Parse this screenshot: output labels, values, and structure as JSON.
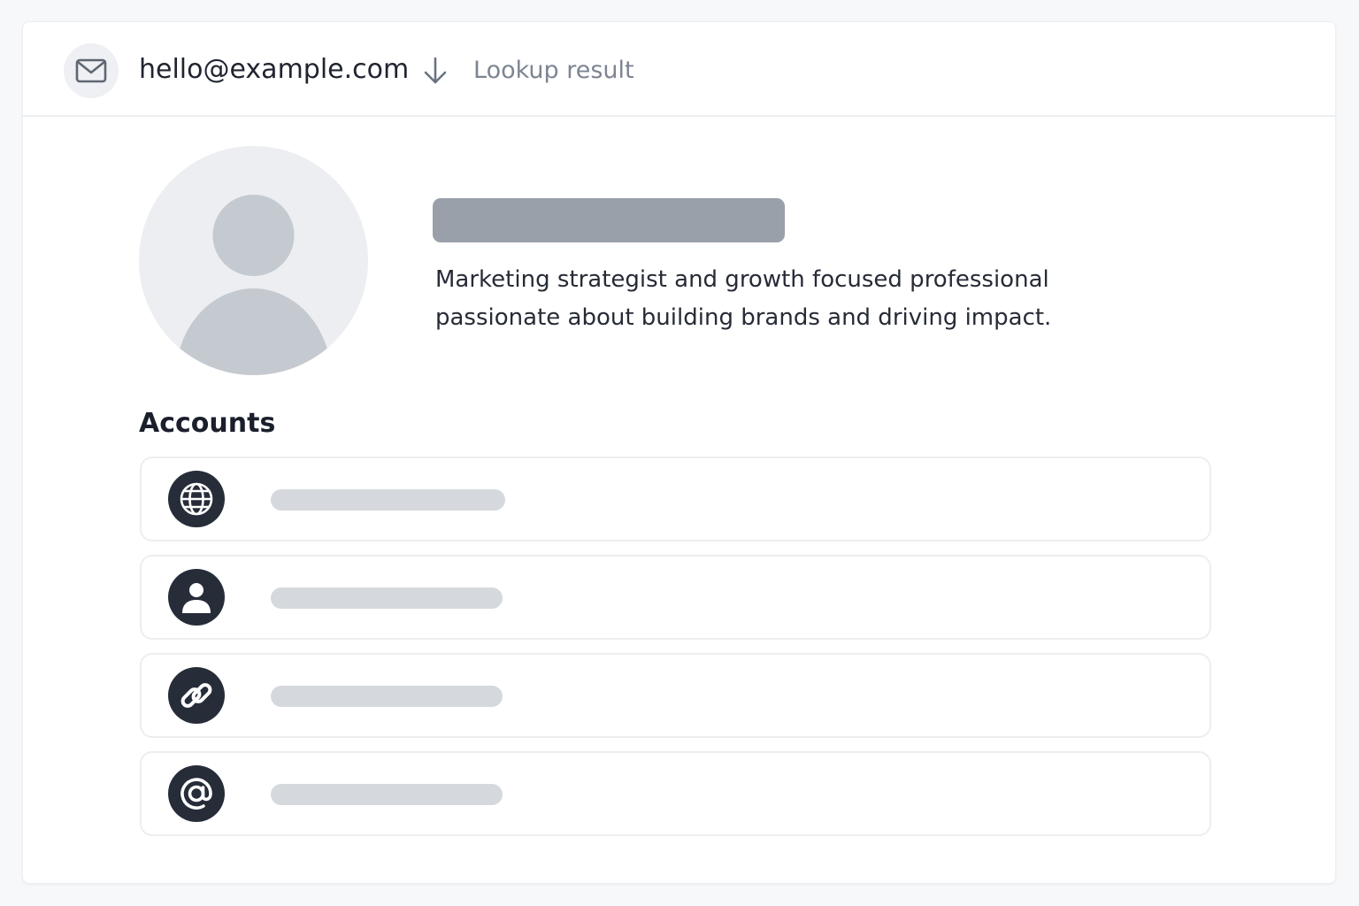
{
  "header": {
    "email": "hello@example.com",
    "status": "Lookup result"
  },
  "profile": {
    "bio_line1": "Marketing strategist and growth focused professional",
    "bio_line2": "passionate about building brands and driving impact."
  },
  "accounts": {
    "title": "Accounts",
    "items": [
      {
        "icon": "globe-icon"
      },
      {
        "icon": "user-icon"
      },
      {
        "icon": "link-icon"
      },
      {
        "icon": "at-sign-icon"
      }
    ]
  },
  "colors": {
    "icon_background": "#262d39",
    "placeholder_dark": "#9aa0aa",
    "placeholder_light": "#d5d8dd",
    "muted_text": "#7d8593"
  }
}
